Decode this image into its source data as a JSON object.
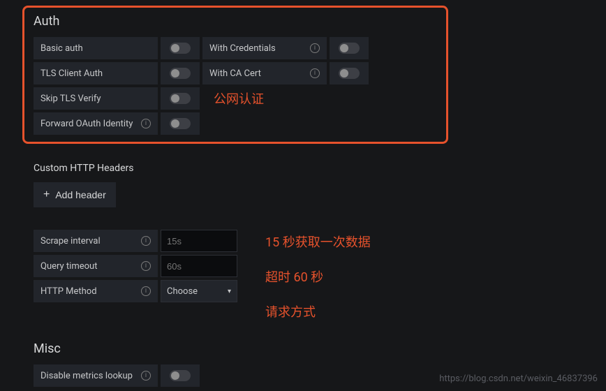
{
  "auth": {
    "title": "Auth",
    "basic_auth": "Basic auth",
    "tls_client_auth": "TLS Client Auth",
    "skip_tls_verify": "Skip TLS Verify",
    "forward_oauth": "Forward OAuth Identity",
    "with_credentials": "With Credentials",
    "with_ca_cert": "With CA Cert",
    "annotation": "公网认证"
  },
  "headers": {
    "title": "Custom HTTP Headers",
    "add_button": "Add header"
  },
  "settings": {
    "scrape_interval_label": "Scrape interval",
    "scrape_interval_placeholder": "15s",
    "query_timeout_label": "Query timeout",
    "query_timeout_placeholder": "60s",
    "http_method_label": "HTTP Method",
    "http_method_value": "Choose",
    "annotation_interval": "15 秒获取一次数据",
    "annotation_timeout": "超时 60 秒",
    "annotation_method": "请求方式"
  },
  "misc": {
    "title": "Misc",
    "disable_metrics": "Disable metrics lookup"
  },
  "watermark": "https://blog.csdn.net/weixin_46837396"
}
